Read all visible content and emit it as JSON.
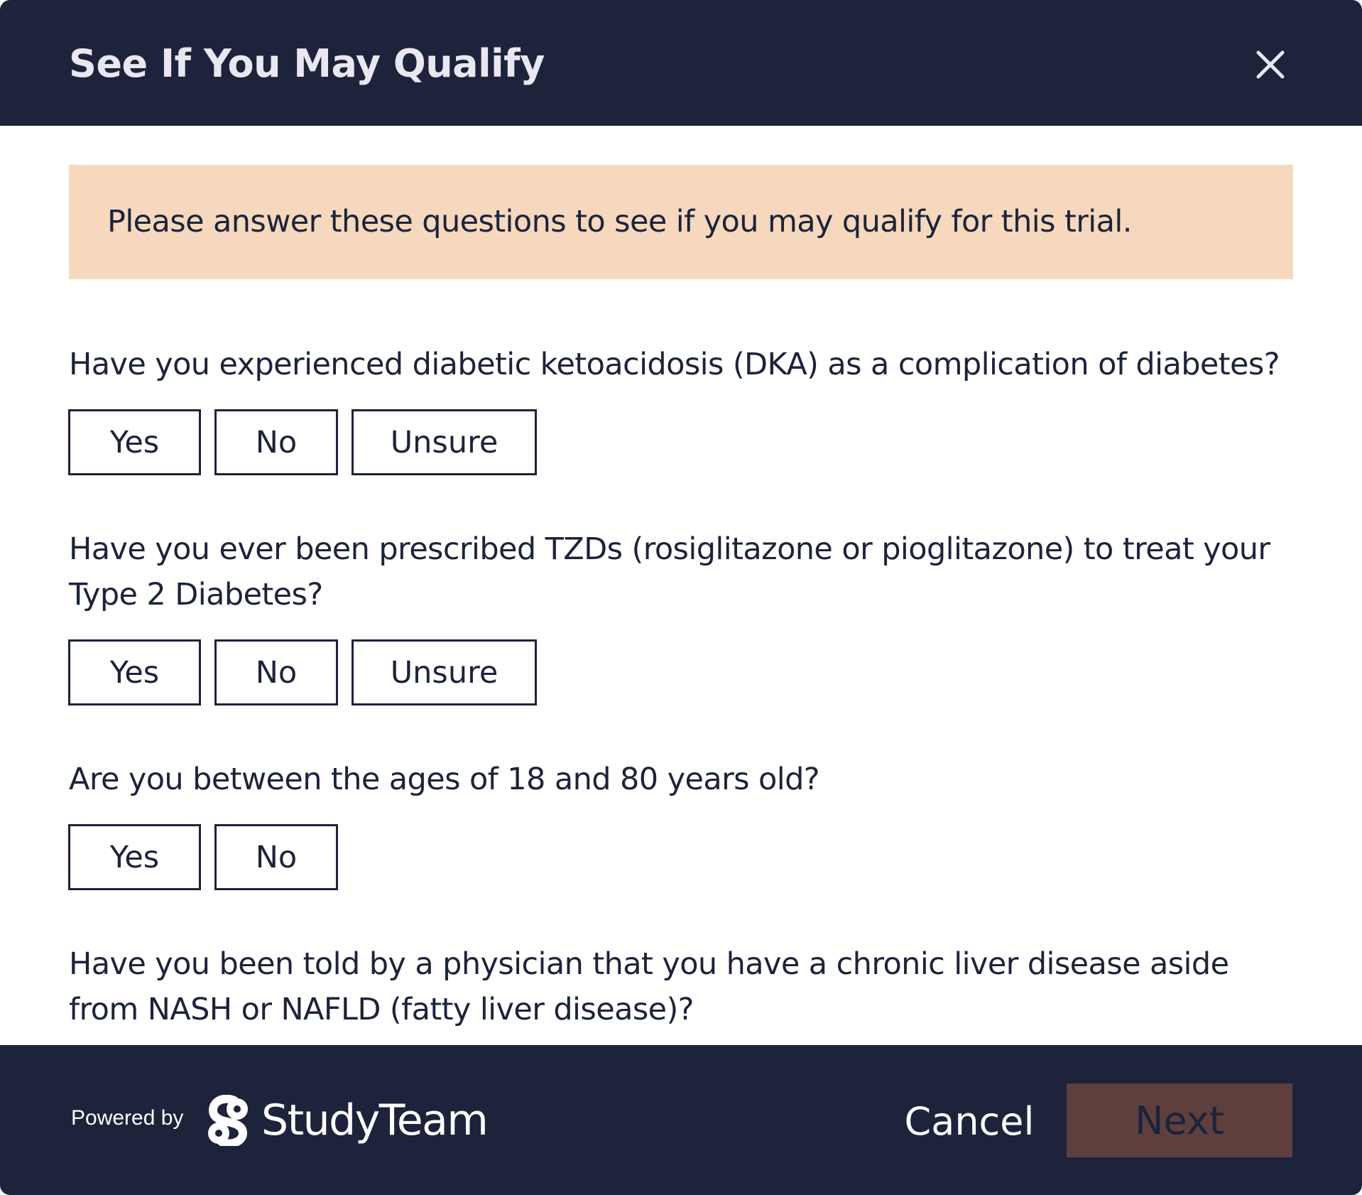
{
  "header": {
    "title": "See If You May Qualify",
    "close_icon": "close-icon"
  },
  "notice": {
    "text": "Please answer these questions to see if you may qualify for this trial."
  },
  "questions": [
    {
      "text": "Have you experienced diabetic ketoacidosis (DKA) as a complication of diabetes?",
      "options": [
        "Yes",
        "No",
        "Unsure"
      ]
    },
    {
      "text": "Have you ever been prescribed TZDs (rosiglitazone or pioglitazone) to treat your Type 2 Diabetes?",
      "options": [
        "Yes",
        "No",
        "Unsure"
      ]
    },
    {
      "text": "Are you between the ages of 18 and 80 years old?",
      "options": [
        "Yes",
        "No"
      ]
    },
    {
      "text": "Have you been told by a physician that you have a chronic liver disease aside from NASH or NAFLD (fatty liver disease)?",
      "options": []
    }
  ],
  "footer": {
    "powered_by": "Powered by",
    "brand": "StudyTeam",
    "brand_icon": "studyteam-logo-icon",
    "cancel_label": "Cancel",
    "next_label": "Next",
    "next_disabled": true
  },
  "colors": {
    "navy": "#1c233b",
    "notice_bg": "#f5d8bd",
    "next_bg": "#5e3f3e",
    "header_text": "#e9e7f1"
  }
}
